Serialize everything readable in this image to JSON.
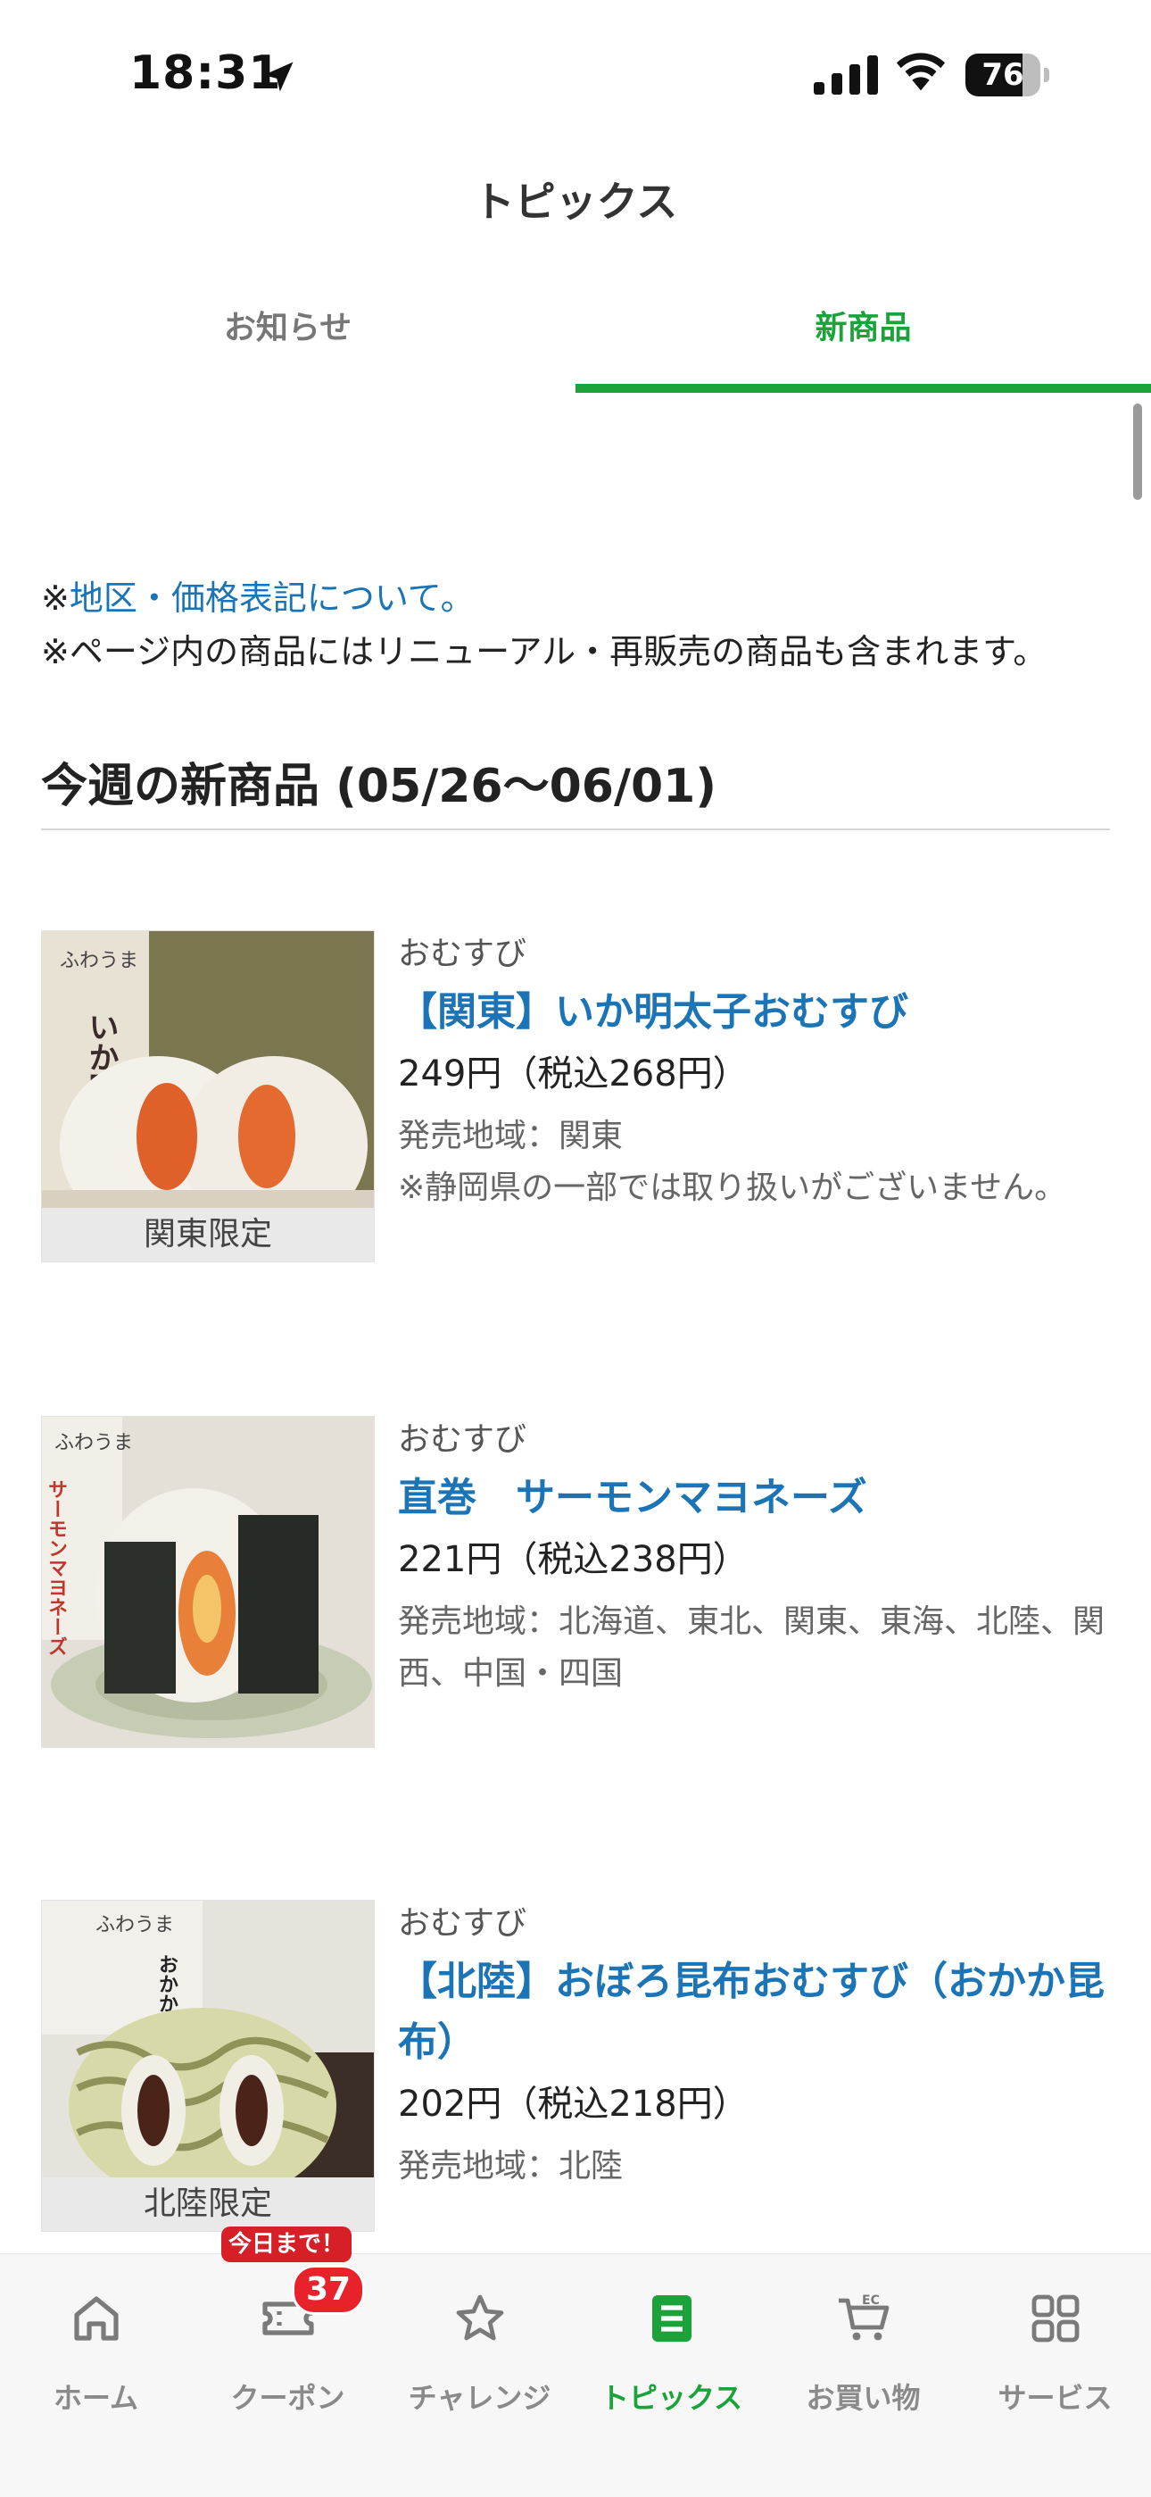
{
  "status_bar": {
    "time": "18:31",
    "battery": "76",
    "battery_level": 0.76
  },
  "header": {
    "title": "トピックス"
  },
  "tabs": [
    {
      "label": "お知らせ",
      "active": false
    },
    {
      "label": "新商品",
      "active": true
    }
  ],
  "notes": {
    "prefix": "※",
    "link_text": "地区・価格表記について。",
    "line2": "※ページ内の商品にはリニューアル・再販売の商品も含まれます。"
  },
  "week_heading": "今週の新商品 (05/26〜06/01)",
  "products": [
    {
      "category": "おむすび",
      "name": "【関東】いか明太子おむすび",
      "price": "249円（税込268円）",
      "area": "発売地域：関東",
      "remark": "※静岡県の一部では取り扱いがございません。",
      "region_tag": "関東限定",
      "package_text": "いか明太子",
      "brand_text": "ふわうま"
    },
    {
      "category": "おむすび",
      "name": "直巻　サーモンマヨネーズ",
      "price": "221円（税込238円）",
      "area": "発売地域：北海道、東北、関東、東海、北陸、関西、中国・四国",
      "remark": "",
      "region_tag": "",
      "package_text": "サーモンマヨネーズ",
      "brand_text": "ふわうま"
    },
    {
      "category": "おむすび",
      "name": "【北陸】おぼろ昆布おむすび（おかか昆布）",
      "price": "202円（税込218円）",
      "area": "発売地域：北陸",
      "remark": "",
      "region_tag": "北陸限定",
      "package_text": "おかか昆布",
      "brand_text": "ふわうま"
    }
  ],
  "bottom_nav": {
    "items": [
      {
        "label": "ホーム",
        "icon": "home-icon",
        "active": false
      },
      {
        "label": "クーポン",
        "icon": "ticket-icon",
        "active": false
      },
      {
        "label": "チャレンジ",
        "icon": "star-icon",
        "active": false
      },
      {
        "label": "トピックス",
        "icon": "document-icon",
        "active": true
      },
      {
        "label": "お買い物",
        "icon": "ec-cart-icon",
        "active": false
      },
      {
        "label": "サービス",
        "icon": "grid-icon",
        "active": false
      }
    ],
    "coupon_badge": "37",
    "coupon_today": "今日まで！"
  },
  "colors": {
    "accent": "#1aa33b",
    "link": "#1a74b5",
    "badge": "#e8222b"
  }
}
